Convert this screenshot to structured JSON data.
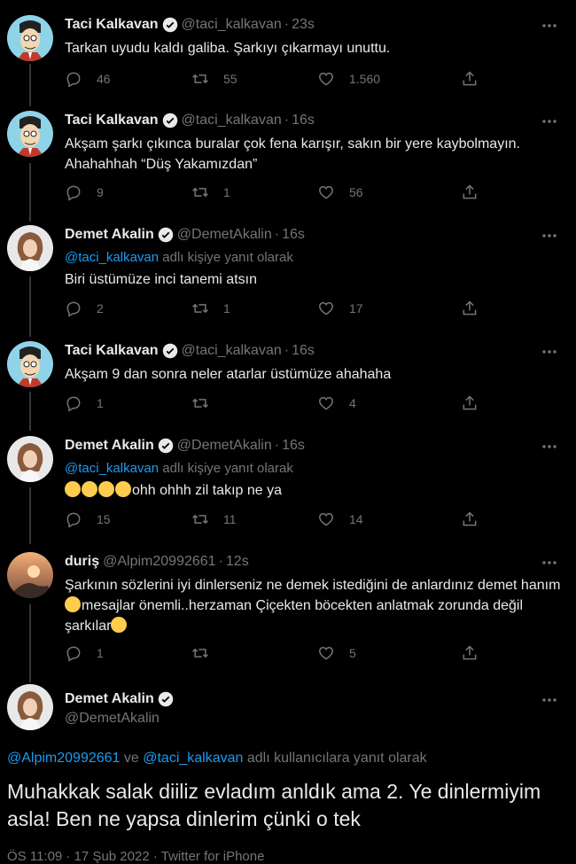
{
  "tweets": [
    {
      "name": "Taci Kalkavan",
      "handle": "@taci_kalkavan",
      "time": "23s",
      "text": "Tarkan uyudu kaldı galiba. Şarkıyı çıkarmayı unuttu.",
      "replies": "46",
      "retweets": "55",
      "likes": "1.560",
      "avatar": "cartoon"
    },
    {
      "name": "Taci Kalkavan",
      "handle": "@taci_kalkavan",
      "time": "16s",
      "text": "Akşam şarkı çıkınca buralar çok fena karışır, sakın bir yere kaybolmayın. Ahahahhah “Düş Yakamızdan”",
      "replies": "9",
      "retweets": "1",
      "likes": "56",
      "avatar": "cartoon"
    },
    {
      "name": "Demet Akalin",
      "handle": "@DemetAkalin",
      "time": "16s",
      "reply_to": "@taci_kalkavan",
      "reply_suffix": " adlı kişiye yanıt olarak",
      "text": "Biri üstümüze inci tanemi atsın",
      "replies": "2",
      "retweets": "1",
      "likes": "17",
      "avatar": "woman"
    },
    {
      "name": "Taci Kalkavan",
      "handle": "@taci_kalkavan",
      "time": "16s",
      "text": "Akşam 9 dan sonra  neler atarlar üstümüze ahahaha",
      "replies": "1",
      "retweets": "",
      "likes": "4",
      "avatar": "cartoon"
    },
    {
      "name": "Demet Akalin",
      "handle": "@DemetAkalin",
      "time": "16s",
      "reply_to": "@taci_kalkavan",
      "reply_suffix": " adlı kişiye yanıt olarak",
      "text": "ohh ohhh zil takıp ne ya",
      "replies": "15",
      "retweets": "11",
      "likes": "14",
      "avatar": "woman"
    },
    {
      "name": "duriş",
      "handle": "@Alpim20992661",
      "time": "12s",
      "text_parts": [
        "Şarkının sözlerini iyi dinlerseniz ne demek istediğini de anlardınız demet hanım",
        "mesajlar önemli..herzaman Çiçekten böcekten anlatmak zorunda değil şarkılar"
      ],
      "replies": "1",
      "retweets": "",
      "likes": "5",
      "avatar": "sunset"
    }
  ],
  "main": {
    "name": "Demet Akalin",
    "handle": "@DemetAkalin",
    "reply_a": "@Alpim20992661",
    "reply_mid": " ve ",
    "reply_b": "@taci_kalkavan",
    "reply_suffix": " adlı kullanıcılara yanıt olarak",
    "text": "Muhakkak salak diiliz evladım anldık ama 2. Ye dinlermiyim asla! Ben ne yapsa dinlerim çünki o tek",
    "footer": "ÖS 11:09 · 17 Şub 2022 · Twitter for iPhone"
  },
  "colors": {
    "background": "#000000",
    "text": "#e7e9ea",
    "muted": "#71767b",
    "link": "#1d9bf0",
    "verified": "#1d9bf0"
  }
}
